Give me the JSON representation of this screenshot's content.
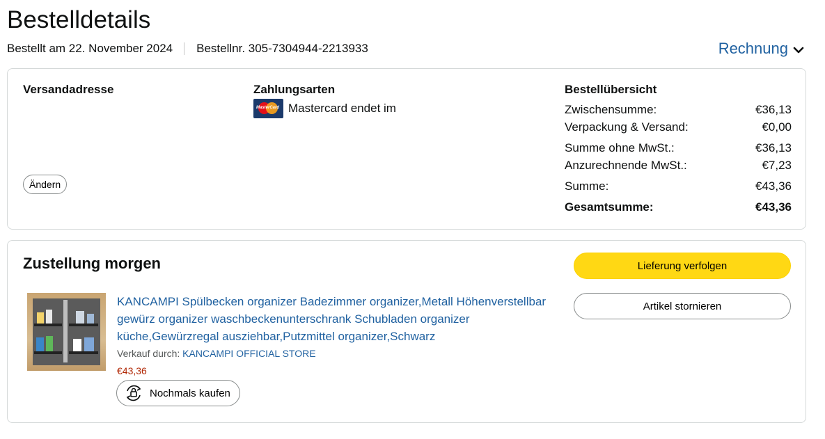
{
  "header": {
    "title": "Bestelldetails",
    "order_date": "Bestellt am 22. November 2024",
    "order_number": "Bestellnr. 305-7304944-2213933",
    "invoice_label": "Rechnung"
  },
  "details": {
    "shipping_title": "Versandadresse",
    "change_label": "Ändern",
    "payment_title": "Zahlungsarten",
    "payment_text": "Mastercard endet im",
    "payment_icon": "mastercard-logo",
    "summary_title": "Bestellübersicht",
    "summary_rows": [
      {
        "label": "Zwischensumme:",
        "value": "€36,13"
      },
      {
        "label": "Verpackung & Versand:",
        "value": "€0,00"
      },
      {
        "label": "Summe ohne MwSt.:",
        "value": "€36,13"
      },
      {
        "label": "Anzurechnende MwSt.:",
        "value": "€7,23"
      },
      {
        "label": "Summe:",
        "value": "€43,36"
      },
      {
        "label": "Gesamtsumme:",
        "value": "€43,36"
      }
    ]
  },
  "delivery": {
    "title": "Zustellung morgen",
    "track_label": "Lieferung verfolgen",
    "cancel_label": "Artikel stornieren",
    "product": {
      "title": "KANCAMPI Spülbecken organizer Badezimmer organizer,Metall Höhenverstellbar gewürz organizer waschbeckenunterschrank Schubladen organizer küche,Gewürzregal ausziehbar,Putzmittel organizer,Schwarz",
      "sold_by_label": "Verkauf durch:",
      "seller": "KANCAMPI OFFICIAL STORE",
      "price": "€43,36",
      "buy_again_label": "Nochmals kaufen"
    }
  },
  "colors": {
    "link": "#2162a1",
    "primary_button": "#ffd814",
    "price": "#b12704",
    "border": "#d5d9d9"
  }
}
